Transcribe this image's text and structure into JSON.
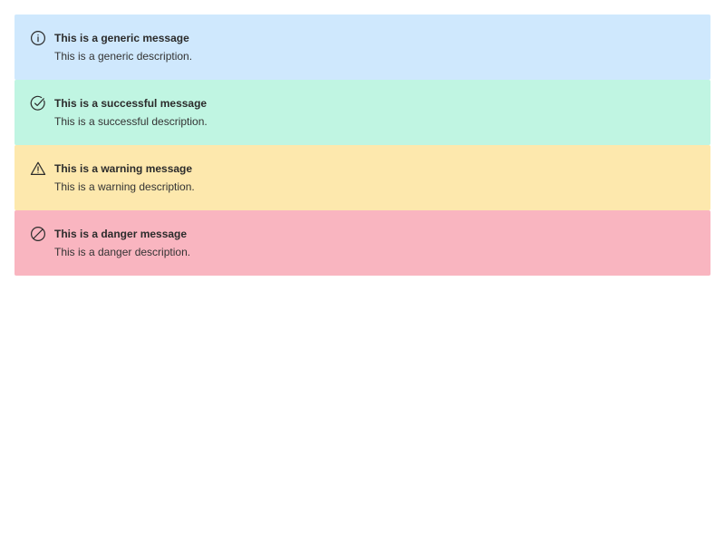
{
  "alerts": {
    "generic": {
      "title": "This is a generic message",
      "description": "This is a generic description.",
      "icon": "info-icon",
      "color": "#cfe8fd"
    },
    "success": {
      "title": "This is a successful message",
      "description": "This is a successful description.",
      "icon": "check-circle-icon",
      "color": "#c0f5e2"
    },
    "warning": {
      "title": "This is a warning message",
      "description": "This is a warning description.",
      "icon": "warning-triangle-icon",
      "color": "#fde8ad"
    },
    "danger": {
      "title": "This is a danger message",
      "description": "This is a danger description.",
      "icon": "prohibited-circle-icon",
      "color": "#f9b5c0"
    }
  }
}
